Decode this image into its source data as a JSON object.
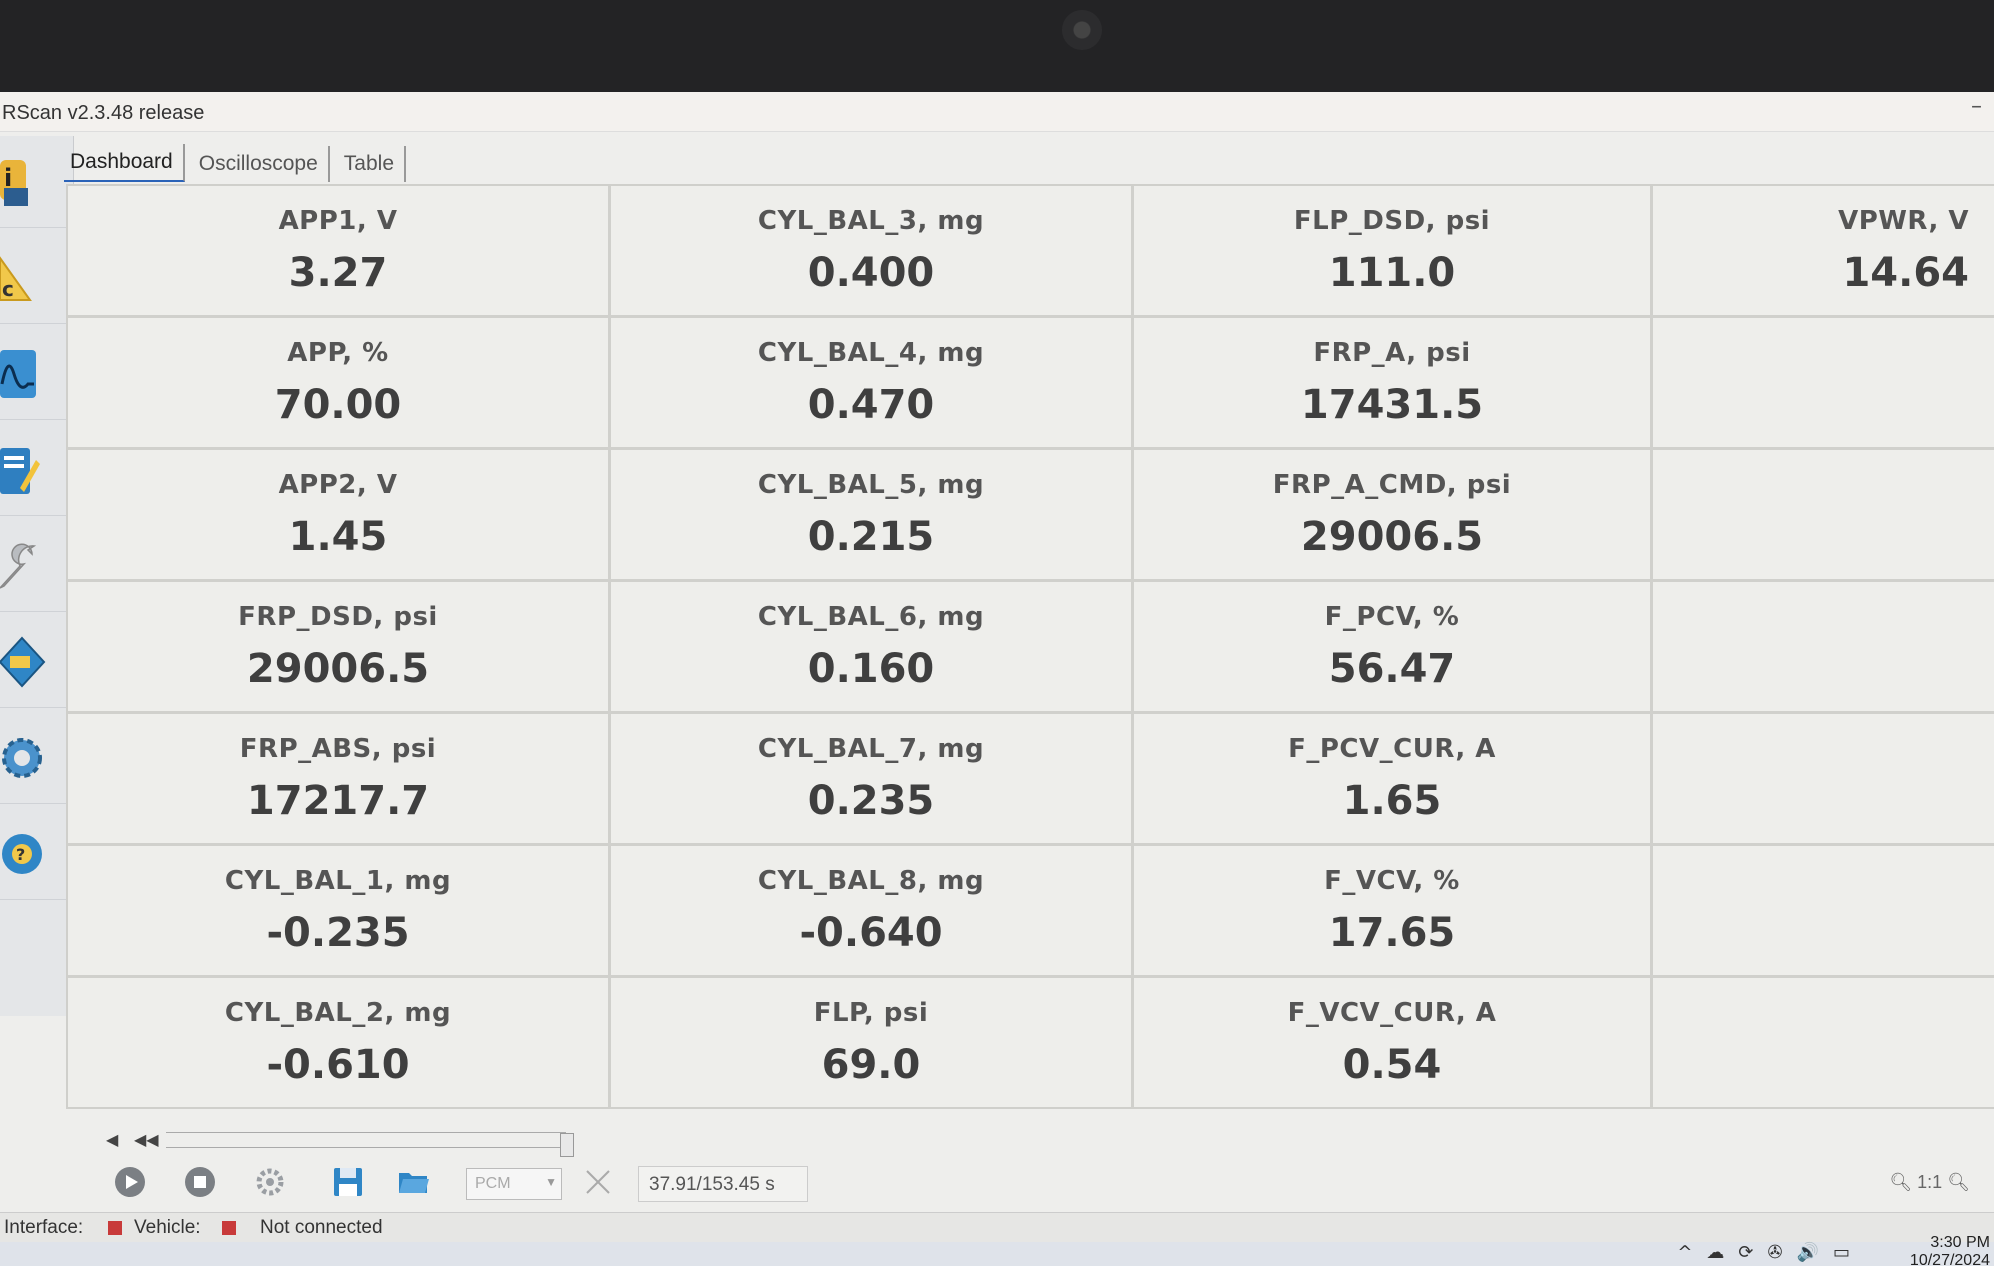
{
  "window": {
    "title": "RScan v2.3.48 release",
    "minimize": "–"
  },
  "tabs": [
    {
      "label": "Dashboard",
      "active": true
    },
    {
      "label": "Oscilloscope",
      "active": false
    },
    {
      "label": "Table",
      "active": false
    }
  ],
  "sidebar": {
    "items": [
      {
        "icon": "info-icon"
      },
      {
        "icon": "dtc-warning-icon"
      },
      {
        "icon": "waveform-icon"
      },
      {
        "icon": "notes-edit-icon"
      },
      {
        "icon": "wrench-icon"
      },
      {
        "icon": "module-icon"
      },
      {
        "icon": "gear-icon"
      },
      {
        "icon": "help-icon"
      }
    ]
  },
  "gauges": {
    "col1": [
      {
        "label": "APP1, V",
        "value": "3.27"
      },
      {
        "label": "APP, %",
        "value": "70.00"
      },
      {
        "label": "APP2, V",
        "value": "1.45"
      },
      {
        "label": "FRP_DSD, psi",
        "value": "29006.5"
      },
      {
        "label": "FRP_ABS, psi",
        "value": "17217.7"
      },
      {
        "label": "CYL_BAL_1, mg",
        "value": "-0.235"
      },
      {
        "label": "CYL_BAL_2, mg",
        "value": "-0.610"
      }
    ],
    "col2": [
      {
        "label": "CYL_BAL_3, mg",
        "value": "0.400"
      },
      {
        "label": "CYL_BAL_4, mg",
        "value": "0.470"
      },
      {
        "label": "CYL_BAL_5, mg",
        "value": "0.215"
      },
      {
        "label": "CYL_BAL_6, mg",
        "value": "0.160"
      },
      {
        "label": "CYL_BAL_7, mg",
        "value": "0.235"
      },
      {
        "label": "CYL_BAL_8, mg",
        "value": "-0.640"
      },
      {
        "label": "FLP, psi",
        "value": "69.0"
      }
    ],
    "col3": [
      {
        "label": "FLP_DSD, psi",
        "value": "111.0"
      },
      {
        "label": "FRP_A, psi",
        "value": "17431.5"
      },
      {
        "label": "FRP_A_CMD, psi",
        "value": "29006.5"
      },
      {
        "label": "F_PCV, %",
        "value": "56.47"
      },
      {
        "label": "F_PCV_CUR, A",
        "value": "1.65"
      },
      {
        "label": "F_VCV, %",
        "value": "17.65"
      },
      {
        "label": "F_VCV_CUR, A",
        "value": "0.54"
      }
    ],
    "col4": [
      {
        "label": "VPWR, V",
        "value": "14.64"
      }
    ]
  },
  "toolbar": {
    "module_select": "PCM",
    "time_position": "37.91/153.45 s",
    "zoom_reset": "1:1"
  },
  "status": {
    "interface_label": "Interface:",
    "vehicle_label": "Vehicle:",
    "connection": "Not connected",
    "indicator_color": "#c83a3a"
  },
  "taskbar": {
    "time": "3:30 PM",
    "date": "10/27/2024"
  }
}
